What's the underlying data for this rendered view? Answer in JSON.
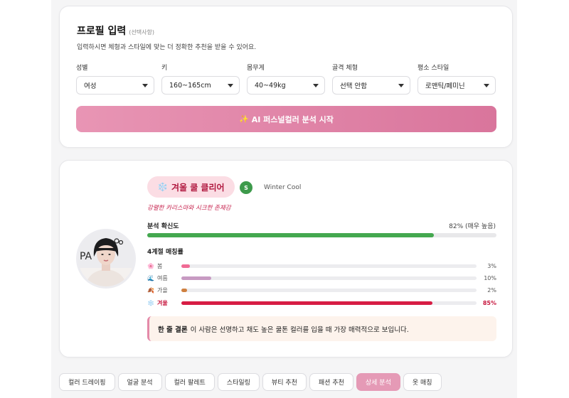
{
  "profile": {
    "title": "프로필 입력",
    "optional": "(선택사항)",
    "description": "입력하시면 체형과 스타일에 맞는 더 정확한 추천을 받을 수 있어요.",
    "fields": [
      {
        "label": "성별",
        "value": "여성"
      },
      {
        "label": "키",
        "value": "160~165cm"
      },
      {
        "label": "몸무게",
        "value": "40~49kg"
      },
      {
        "label": "골격 체형",
        "value": "선택 안함"
      },
      {
        "label": "평소 스타일",
        "value": "로맨틱/페미닌"
      }
    ],
    "cta_icon": "✨",
    "cta_label": "AI 퍼스널컬러 분석 시작"
  },
  "result": {
    "season_icon": "❄️",
    "season_name": "겨울 쿨 클리어",
    "grade_badge": "S",
    "season_en": "Winter Cool",
    "tagline": "강렬한 카리스마와 시크한 존재감",
    "confidence_label": "분석 확신도",
    "confidence_text": "82% (매우 높음)",
    "confidence_value": 82,
    "match_title": "4계절 매칭률",
    "matches": [
      {
        "icon": "🌸",
        "name": "봄",
        "value": 3,
        "text": "3%",
        "color": "#f06b95"
      },
      {
        "icon": "🌊",
        "name": "여름",
        "value": 10,
        "text": "10%",
        "color": "#c79ac2"
      },
      {
        "icon": "🍂",
        "name": "가을",
        "value": 2,
        "text": "2%",
        "color": "#cf8040"
      },
      {
        "icon": "❄️",
        "name": "겨울",
        "value": 85,
        "text": "85%",
        "color": "#d71d44"
      }
    ],
    "conclusion_label": "한 줄 결론",
    "conclusion_text": "이 사람은 선명하고 채도 높은 쿨톤 컬러를 입을 때 가장 매력적으로 보입니다."
  },
  "tabs": [
    {
      "label": "컬러 드레이핑"
    },
    {
      "label": "얼굴 분석"
    },
    {
      "label": "컬러 팔레트"
    },
    {
      "label": "스타일링"
    },
    {
      "label": "뷰티 추천"
    },
    {
      "label": "패션 추천"
    },
    {
      "label": "상세 분석",
      "active": true
    },
    {
      "label": "옷 매칭"
    }
  ],
  "colors": {
    "accent": "#e59ab6",
    "confidence": "#44a84f",
    "winter": "#d71d44"
  }
}
